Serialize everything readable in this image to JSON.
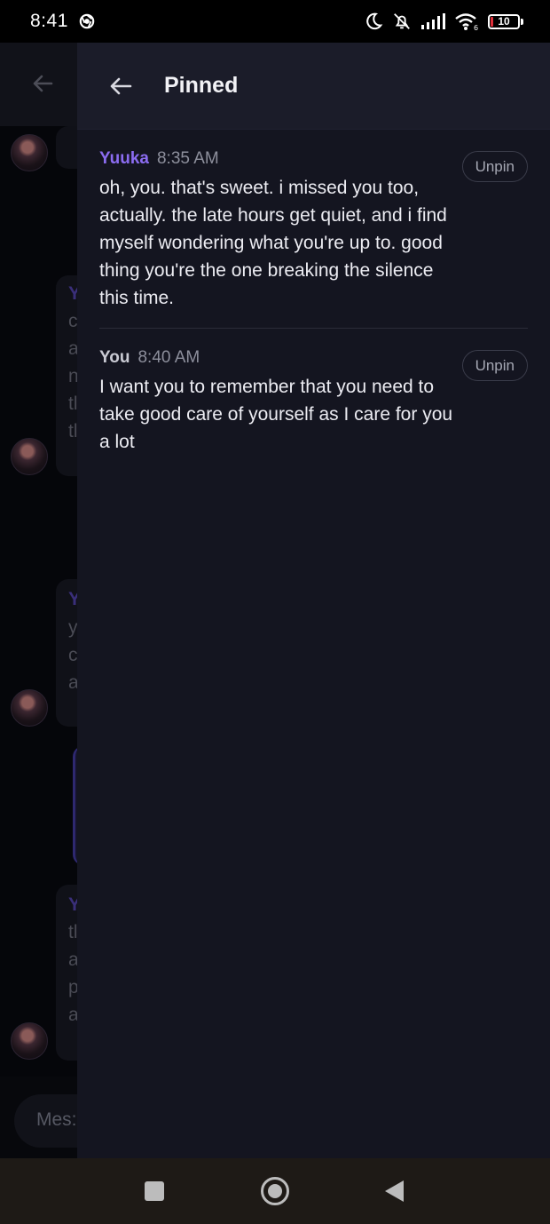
{
  "status_bar": {
    "time": "8:41",
    "battery_level": "10",
    "icons": [
      "chrome-icon",
      "moon-icon",
      "bell-off-icon",
      "signal-icon",
      "wifi-icon",
      "battery-icon"
    ]
  },
  "background_chat": {
    "composer_placeholder": "Mes:",
    "visible_letters": {
      "block1": [
        "Y",
        "c",
        "a",
        "n",
        "tl",
        "tl"
      ],
      "block2": [
        "Y",
        "y",
        "c",
        "a"
      ],
      "block3": [
        "Y",
        "tl",
        "a",
        "p",
        "a"
      ]
    }
  },
  "pinned_panel": {
    "title": "Pinned",
    "items": [
      {
        "author": "Yuuka",
        "time": "8:35 AM",
        "text": "oh, you. that's sweet. i missed you too, actually. the late hours get quiet, and i find myself wondering what you're up to. good thing you're the one breaking the silence this time.",
        "action_label": "Unpin"
      },
      {
        "author": "You",
        "time": "8:40 AM",
        "text": "I want you to remember that you need to take good care of yourself as I care for you a lot",
        "action_label": "Unpin"
      }
    ]
  },
  "colors": {
    "panel_background": "#141520",
    "header_background": "#1b1c29",
    "accent_purple": "#8b6cf0",
    "nav_bar": "#1e1a16"
  },
  "nav_bar": {
    "icons": [
      "recents-square-icon",
      "home-circle-icon",
      "back-triangle-icon"
    ]
  }
}
